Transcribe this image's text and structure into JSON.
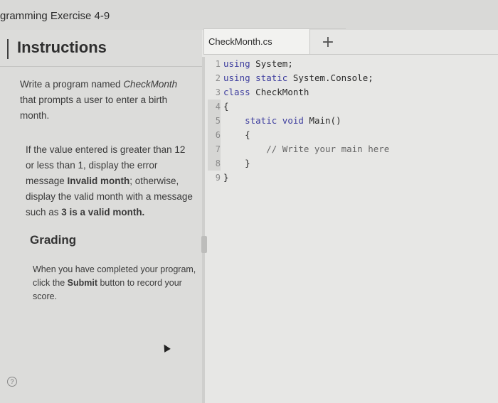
{
  "page": {
    "title": "gramming Exercise 4-9"
  },
  "instructions": {
    "heading": "Instructions",
    "paragraph1_parts": [
      {
        "t": "Write a program named ",
        "s": "normal"
      },
      {
        "t": "CheckMonth",
        "s": "italic"
      },
      {
        "t": " that prompts a user to enter a birth month.",
        "s": "normal"
      }
    ],
    "paragraph2_parts": [
      {
        "t": "If the value entered is greater than 12 or less than 1, display the error message ",
        "s": "normal"
      },
      {
        "t": "Invalid month",
        "s": "bold"
      },
      {
        "t": "; otherwise, display the valid month with a message such as ",
        "s": "normal"
      },
      {
        "t": "3 is a valid month.",
        "s": "bold"
      }
    ],
    "grading_heading": "Grading",
    "paragraph3_parts": [
      {
        "t": "When you have completed your program, click the ",
        "s": "normal"
      },
      {
        "t": "Submit",
        "s": "bold"
      },
      {
        "t": " button to record your score.",
        "s": "normal"
      }
    ]
  },
  "editor": {
    "tab_label": "CheckMonth.cs",
    "add_tab_symbol": "+",
    "lines": [
      {
        "num": "1",
        "code": "using System;"
      },
      {
        "num": "2",
        "code": "using static System.Console;"
      },
      {
        "num": "3",
        "code": "class CheckMonth"
      },
      {
        "num": "4",
        "code": "{"
      },
      {
        "num": "5",
        "code": "    static void Main()"
      },
      {
        "num": "6",
        "code": "    {"
      },
      {
        "num": "7",
        "code": "        // Write your main here"
      },
      {
        "num": "8",
        "code": "    }"
      },
      {
        "num": "9",
        "code": "}"
      }
    ]
  },
  "icons": {
    "help": "help-icon",
    "cursor": "mouse-cursor-icon"
  }
}
